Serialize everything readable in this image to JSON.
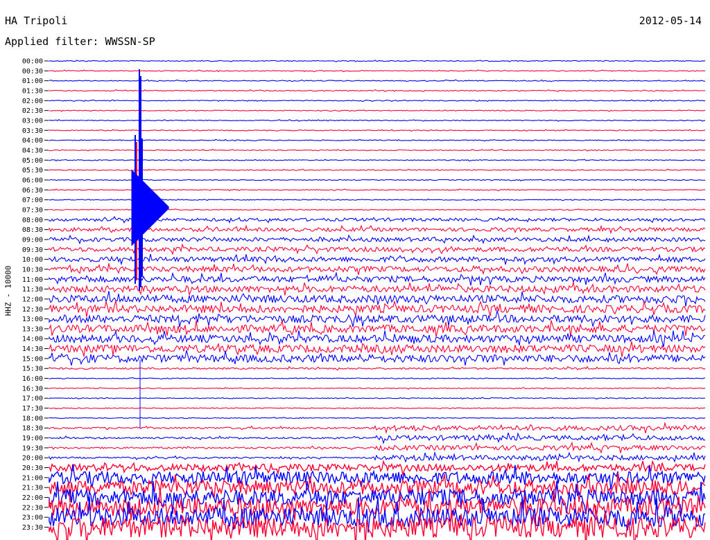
{
  "header": {
    "station": "HA Tripoli",
    "date": "2012-05-14",
    "filter": "Applied filter: WWSSN-SP"
  },
  "axis": {
    "ylabel": "HHZ - 10000"
  },
  "colors": {
    "trace_a": "#0000ff",
    "trace_b": "#ff0033",
    "background": "#ffffff"
  },
  "chart_data": {
    "type": "helicorder",
    "times": [
      "00:00",
      "00:30",
      "01:00",
      "01:30",
      "02:00",
      "02:30",
      "03:00",
      "03:30",
      "04:00",
      "04:30",
      "05:00",
      "05:30",
      "06:00",
      "06:30",
      "07:00",
      "07:30",
      "08:00",
      "08:30",
      "09:00",
      "09:30",
      "10:00",
      "10:30",
      "11:00",
      "11:30",
      "12:00",
      "12:30",
      "13:00",
      "13:30",
      "14:00",
      "14:30",
      "15:00",
      "15:30",
      "16:00",
      "16:30",
      "17:00",
      "17:30",
      "18:00",
      "18:30",
      "19:00",
      "19:30",
      "20:00",
      "20:30",
      "21:00",
      "21:30",
      "22:00",
      "22:30",
      "23:00",
      "23:30"
    ],
    "series_colors": [
      "blue",
      "red"
    ]
  }
}
